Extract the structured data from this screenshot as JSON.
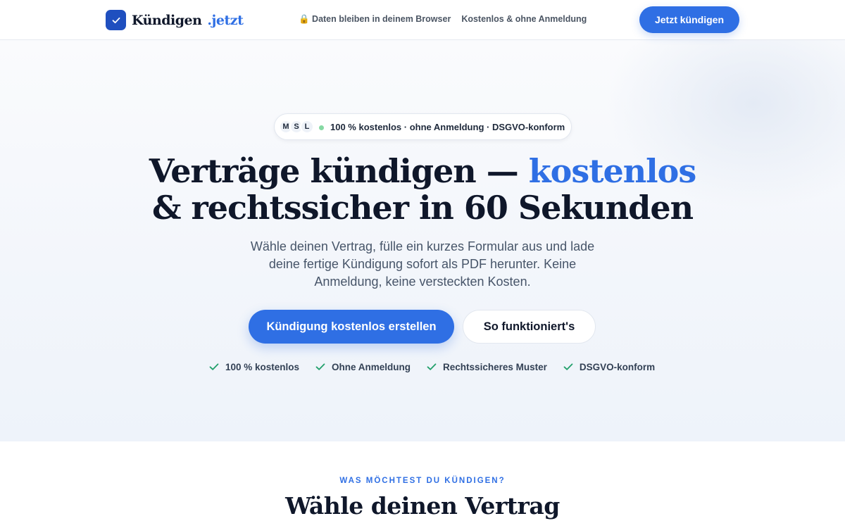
{
  "header": {
    "logo_text": "Kündigen",
    "logo_tld": ".jetzt",
    "logo_icon": "check-icon",
    "nav": [
      "🔒 Daten bleiben in deinem Browser",
      "Kostenlos & ohne Anmeldung"
    ],
    "cta_label": "Jetzt kündigen"
  },
  "hero": {
    "pill": {
      "avatars": [
        "M",
        "S",
        "L"
      ],
      "text": "100 % kostenlos · ohne Anmeldung · DSGVO-konform"
    },
    "title_line1": "Verträge kündigen — ",
    "title_accent": "kostenlos",
    "title_line2": "& rechtssicher in 60 Sekunden",
    "lead": "Wähle deinen Vertrag, fülle ein kurzes Formular aus und lade deine fertige Kündigung sofort als PDF herunter. Keine Anmeldung, keine versteckten Kosten.",
    "primary_button": "Kündigung kostenlos erstellen",
    "secondary_button": "So funktioniert's",
    "checks": [
      "100 % kostenlos",
      "Ohne Anmeldung",
      "Rechtssicheres Muster",
      "DSGVO-konform"
    ]
  },
  "section": {
    "eyebrow": "WAS MÖCHTEST DU KÜNDIGEN?",
    "title": "Wähle deinen Vertrag"
  },
  "colors": {
    "accent": "#2f6fe4",
    "logo_bg": "#1f4fbf",
    "check_green": "#22a06b",
    "pill_dot": "#86d9a3"
  }
}
